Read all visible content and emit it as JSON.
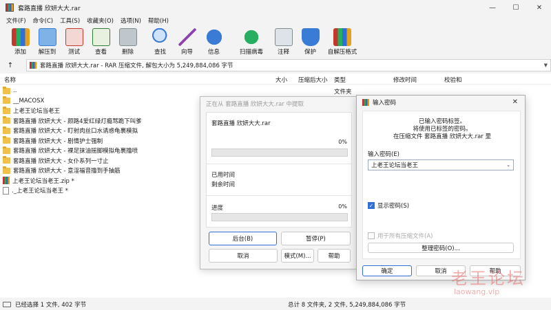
{
  "window": {
    "title": "套路直播 欣妍大大.rar"
  },
  "window_controls": {
    "minimize": "—",
    "maximize": "☐",
    "close": "✕"
  },
  "menu": [
    "文件(F)",
    "命令(C)",
    "工具(S)",
    "收藏夹(O)",
    "选项(N)",
    "帮助(H)"
  ],
  "toolbar": [
    {
      "label": "添加",
      "icon": "add-archive-icon",
      "color": "#c0392b"
    },
    {
      "label": "解压到",
      "icon": "extract-folder-icon",
      "color": "#3a7bd5"
    },
    {
      "label": "测试",
      "icon": "test-archive-icon",
      "color": "#c0392b"
    },
    {
      "label": "查看",
      "icon": "view-book-icon",
      "color": "#2e7d32"
    },
    {
      "label": "删除",
      "icon": "delete-trash-icon",
      "color": "#7f8c8d"
    },
    {
      "label": "查找",
      "icon": "find-magnifier-icon",
      "color": "#3a7bd5"
    },
    {
      "label": "向导",
      "icon": "wizard-wand-icon",
      "color": "#8e44ad"
    },
    {
      "label": "信息",
      "icon": "info-icon",
      "color": "#3a7bd5"
    },
    {
      "label": "扫描病毒",
      "icon": "virus-scan-icon",
      "color": "#27ae60"
    },
    {
      "label": "注释",
      "icon": "comment-icon",
      "color": "#7f8c8d"
    },
    {
      "label": "保护",
      "icon": "shield-icon",
      "color": "#3a7bd5"
    },
    {
      "label": "自解压格式",
      "icon": "sfx-icon",
      "color": "#c0392b"
    }
  ],
  "address": {
    "text": "套路直播 欣妍大大.rar - RAR 压缩文件, 解包大小为 5,249,884,086 字节"
  },
  "columns": {
    "name": "名称",
    "size": "大小",
    "packed": "压缩后大小",
    "type": "类型",
    "modified": "修改时间",
    "crc": "校验和"
  },
  "rows": [
    {
      "name": "..",
      "kind": "folder"
    },
    {
      "name": "__MACOSX",
      "kind": "folder"
    },
    {
      "name": "上老王论坛当老王",
      "kind": "folder"
    },
    {
      "name": "套路直播 欣妍大大 - 颜路4爱红绿灯瘾骂跪下叫爹",
      "kind": "folder"
    },
    {
      "name": "套路直播 欣妍大大 - 盯射肉丝口水诱惑龟裹模拟",
      "kind": "folder"
    },
    {
      "name": "套路直播 欣妍大大 - 剧情护士强制",
      "kind": "folder"
    },
    {
      "name": "套路直播 欣妍大大 - 裸足抹油摇脚模拟龟裹撸喷",
      "kind": "folder"
    },
    {
      "name": "套路直播 欣妍大大 - 女仆系列一寸止",
      "kind": "folder"
    },
    {
      "name": "套路直播 欣妍大大 - 意淫福音撸到手抽筋",
      "kind": "folder"
    },
    {
      "name": "上老王论坛当老王.zip *",
      "kind": "rar"
    },
    {
      "name": "._上老王论坛当老王 *",
      "kind": "txt"
    }
  ],
  "first_row_type": "文件夹",
  "status": {
    "left": "已经选择 1 文件, 402 字节",
    "right": "总计 8 文件夹, 2 文件, 5,249,884,086 字节"
  },
  "extract_dialog": {
    "title": "正在从 套路直播 欣妍大大.rar 中提取",
    "file": "套路直播 欣妍大大.rar",
    "file_pct": "0%",
    "file_progress": 0,
    "elapsed_label": "已用时间",
    "remaining_label": "剩余时间",
    "progress_label": "进度",
    "total_pct": "0%",
    "total_progress": 0,
    "btn_background": "后台(B)",
    "btn_pause": "暂停(P)",
    "btn_cancel": "取消",
    "btn_mode": "模式(M)...",
    "btn_help": "帮助"
  },
  "password_dialog": {
    "title": "输入密码",
    "msg1": "已输入密码标签。",
    "msg2": "将使用已标签的密码。",
    "msg3": "在压缩文件 套路直播 欣妍大大.rar 里",
    "input_label": "输入密码(E)",
    "input_value": "上老王论坛当老王",
    "show_password": "显示密码(S)",
    "show_password_checked": true,
    "use_all": "用于所有压缩文件(A)",
    "use_all_checked": false,
    "organize_btn": "整理密码(O)...",
    "ok": "确定",
    "cancel": "取消",
    "help": "帮助"
  },
  "watermark": {
    "cn": "老王论坛",
    "url": "laowang.vip"
  }
}
